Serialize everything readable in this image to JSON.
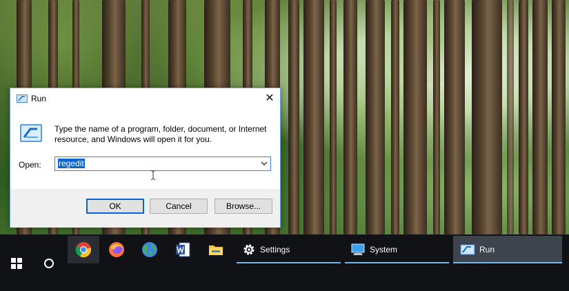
{
  "run_dialog": {
    "title": "Run",
    "description": "Type the name of a program, folder, document, or Internet resource, and Windows will open it for you.",
    "open_label": "Open:",
    "open_value": "regedit",
    "buttons": {
      "ok": "OK",
      "cancel": "Cancel",
      "browse": "Browse..."
    },
    "icons": {
      "title": "run-icon",
      "close": "close-icon",
      "combo": "chevron-down-icon"
    }
  },
  "taskbar": {
    "pinned_apps": [
      {
        "name": "chrome-icon"
      },
      {
        "name": "firefox-icon"
      },
      {
        "name": "globe-icon"
      },
      {
        "name": "word-icon"
      },
      {
        "name": "file-explorer-icon"
      }
    ],
    "windows": [
      {
        "label": "Settings",
        "icon": "gear-icon"
      },
      {
        "label": "System",
        "icon": "computer-icon"
      },
      {
        "label": "Run",
        "icon": "run-icon"
      }
    ]
  },
  "colors": {
    "accent": "#0a64d6",
    "selection": "#0a66cc",
    "taskbar": "#101216",
    "active_underline": "#76b9ed"
  }
}
